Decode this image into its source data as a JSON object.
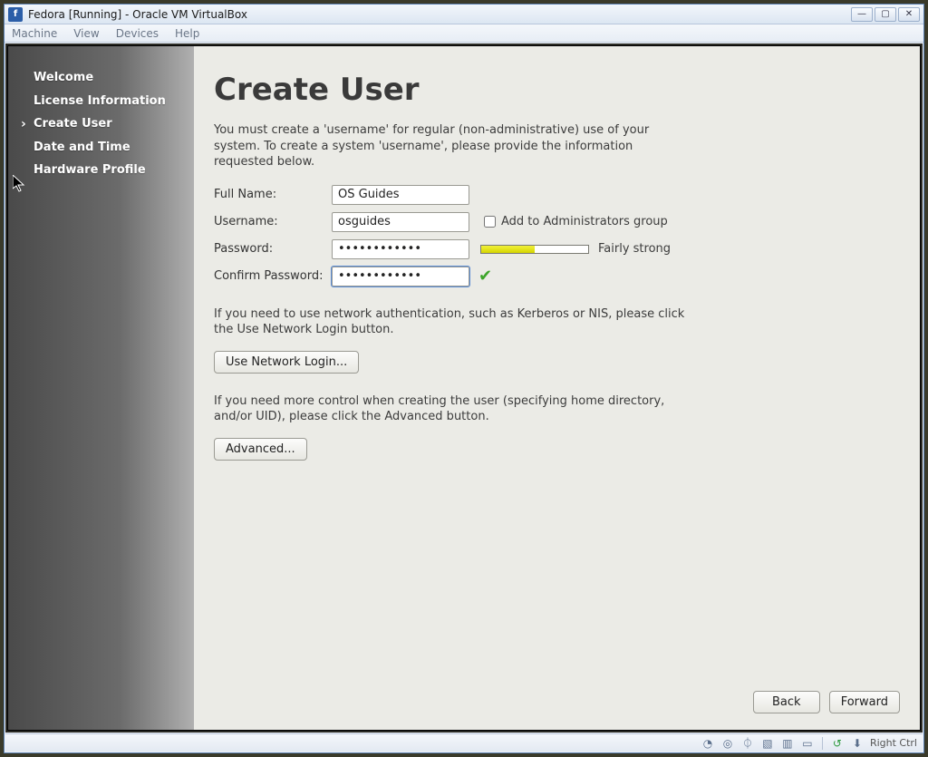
{
  "window": {
    "title": "Fedora [Running] - Oracle VM VirtualBox",
    "menu": {
      "machine": "Machine",
      "view": "View",
      "devices": "Devices",
      "help": "Help"
    }
  },
  "sidebar": {
    "items": [
      {
        "label": "Welcome"
      },
      {
        "label": "License Information"
      },
      {
        "label": "Create User",
        "current": true
      },
      {
        "label": "Date and Time"
      },
      {
        "label": "Hardware Profile"
      }
    ]
  },
  "content": {
    "heading": "Create User",
    "intro": "You must create a 'username' for regular (non-administrative) use of your system.  To create a system 'username', please provide the information requested below.",
    "fields": {
      "fullname_label": "Full Name:",
      "fullname_value": "OS Guides",
      "username_label": "Username:",
      "username_value": "osguides",
      "admin_label": "Add to Administrators group",
      "password_label": "Password:",
      "password_value": "••••••••••••",
      "strength_text": "Fairly strong",
      "strength_percent": 50,
      "confirm_label": "Confirm Password:",
      "confirm_value": "••••••••••••"
    },
    "network_text": "If you need to use network authentication, such as Kerberos or NIS, please click the Use Network Login button.",
    "network_button": "Use Network Login...",
    "advanced_text": "If you need more control when creating the user (specifying home directory, and/or UID), please click the Advanced button.",
    "advanced_button": "Advanced...",
    "nav": {
      "back": "Back",
      "forward": "Forward"
    }
  },
  "statusbar": {
    "host_key": "Right Ctrl"
  }
}
